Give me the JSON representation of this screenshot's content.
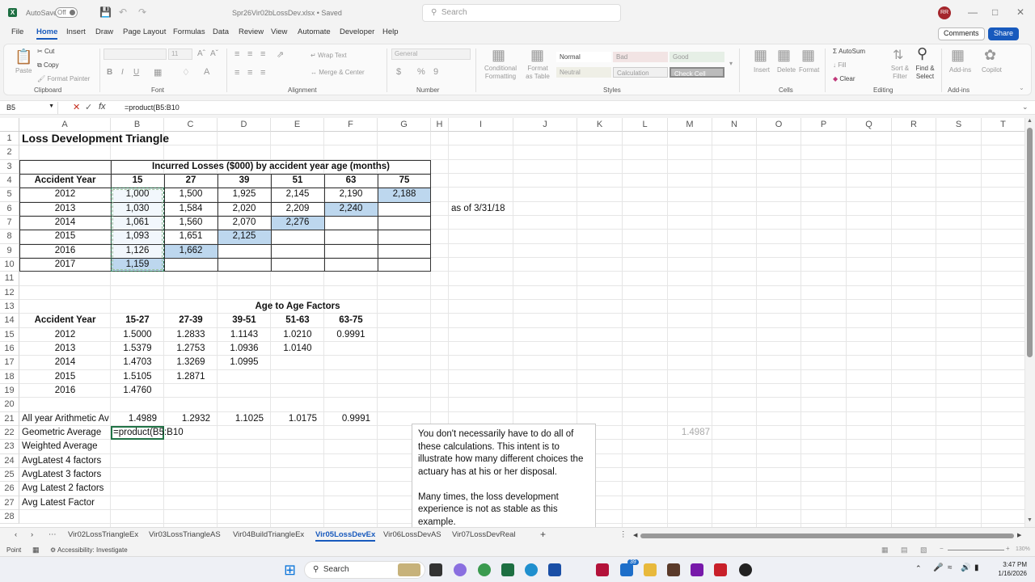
{
  "titlebar": {
    "autosave_label": "AutoSave",
    "autosave_state": "Off",
    "filename": "Spr26Vir02bLossDev.xlsx • Saved",
    "search_placeholder": "Search",
    "user_initials": "RR"
  },
  "menu": [
    "File",
    "Home",
    "Insert",
    "Draw",
    "Page Layout",
    "Formulas",
    "Data",
    "Review",
    "View",
    "Automate",
    "Developer",
    "Help"
  ],
  "menu_active": "Home",
  "comments_label": "Comments",
  "share_label": "Share",
  "ribbon": {
    "clipboard": {
      "paste": "Paste",
      "cut": "Cut",
      "copy": "Copy",
      "format_painter": "Format Painter",
      "group": "Clipboard"
    },
    "font": {
      "size": "11",
      "group": "Font"
    },
    "alignment": {
      "wrap": "Wrap Text",
      "merge": "Merge & Center",
      "group": "Alignment"
    },
    "number": {
      "format": "General",
      "group": "Number"
    },
    "styles": {
      "conditional": "Conditional Formatting",
      "format_table": "Format as Table",
      "normal": "Normal",
      "bad": "Bad",
      "good": "Good",
      "neutral": "Neutral",
      "calculation": "Calculation",
      "check_cell": "Check Cell",
      "group": "Styles"
    },
    "cells": {
      "insert": "Insert",
      "delete": "Delete",
      "format": "Format",
      "group": "Cells"
    },
    "editing": {
      "autosum": "AutoSum",
      "fill": "Fill",
      "clear": "Clear",
      "sort": "Sort & Filter",
      "find": "Find & Select",
      "group": "Editing"
    },
    "addins": {
      "addins": "Add-ins",
      "copilot": "Copilot",
      "group": "Add-ins"
    }
  },
  "formula_bar": {
    "name_box": "B5",
    "formula": "=product(B5:B10"
  },
  "columns": [
    "A",
    "B",
    "C",
    "D",
    "E",
    "F",
    "G",
    "H",
    "I",
    "J",
    "K",
    "L",
    "M",
    "N",
    "O",
    "P",
    "Q",
    "R",
    "S",
    "T"
  ],
  "rows": [
    "1",
    "2",
    "3",
    "4",
    "5",
    "6",
    "7",
    "8",
    "9",
    "10",
    "11",
    "12",
    "13",
    "14",
    "15",
    "16",
    "17",
    "18",
    "19",
    "20",
    "21",
    "22",
    "23",
    "24",
    "25",
    "26",
    "27",
    "28"
  ],
  "sheet": {
    "title": "Loss Development Triangle",
    "incurred_header": "Incurred Losses ($000) by accident year age (months)",
    "accident_year_label": "Accident Year",
    "ages": [
      "15",
      "27",
      "39",
      "51",
      "63",
      "75"
    ],
    "triangle": [
      {
        "year": "2012",
        "values": [
          "1,000",
          "1,500",
          "1,925",
          "2,145",
          "2,190",
          "2,188"
        ]
      },
      {
        "year": "2013",
        "values": [
          "1,030",
          "1,584",
          "2,020",
          "2,209",
          "2,240"
        ]
      },
      {
        "year": "2014",
        "values": [
          "1,061",
          "1,560",
          "2,070",
          "2,276"
        ]
      },
      {
        "year": "2015",
        "values": [
          "1,093",
          "1,651",
          "2,125"
        ]
      },
      {
        "year": "2016",
        "values": [
          "1,126",
          "1,662"
        ]
      },
      {
        "year": "2017",
        "values": [
          "1,159"
        ]
      }
    ],
    "as_of_note": "as of 3/31/18",
    "factors_title": "Age to Age Factors",
    "factor_ages": [
      "15-27",
      "27-39",
      "39-51",
      "51-63",
      "63-75"
    ],
    "factors": [
      {
        "year": "2012",
        "values": [
          "1.5000",
          "1.2833",
          "1.1143",
          "1.0210",
          "0.9991"
        ]
      },
      {
        "year": "2013",
        "values": [
          "1.5379",
          "1.2753",
          "1.0936",
          "1.0140"
        ]
      },
      {
        "year": "2014",
        "values": [
          "1.4703",
          "1.3269",
          "1.0995"
        ]
      },
      {
        "year": "2015",
        "values": [
          "1.5105",
          "1.2871"
        ]
      },
      {
        "year": "2016",
        "values": [
          "1.4760"
        ]
      }
    ],
    "arith_label": "All year Arithmetic Av",
    "arith_values": [
      "1.4989",
      "1.2932",
      "1.1025",
      "1.0175",
      "0.9991"
    ],
    "geo_label": "Geometric Average",
    "geo_formula": "=product(B5:B10",
    "labels": [
      "Weighted Average",
      "AvgLatest 4 factors",
      "AvgLatest 3 factors",
      "Avg Latest 2 factors",
      "Avg Latest Factor"
    ],
    "ghost_value": "1.4987",
    "comment": "You don't necessarily have to do all of these calculations. This intent is to illustrate how many different choices the actuary has at his or her disposal.\n\nMany times, the loss development experience is not as stable as this example."
  },
  "sheet_tabs": [
    "Vir02LossTriangleEx",
    "Vir03LossTriangleAS",
    "Vir04BuildTriangleEx",
    "Vir05LossDevEx",
    "Vir06LossDevAS",
    "Vir07LossDevReal"
  ],
  "active_tab": "Vir05LossDevEx",
  "status": {
    "mode": "Point",
    "accessibility": "Accessibility: Investigate",
    "zoom": "130%"
  },
  "taskbar": {
    "search": "Search",
    "time": "3:47 PM",
    "date": "1/16/2026",
    "badge": "39"
  }
}
